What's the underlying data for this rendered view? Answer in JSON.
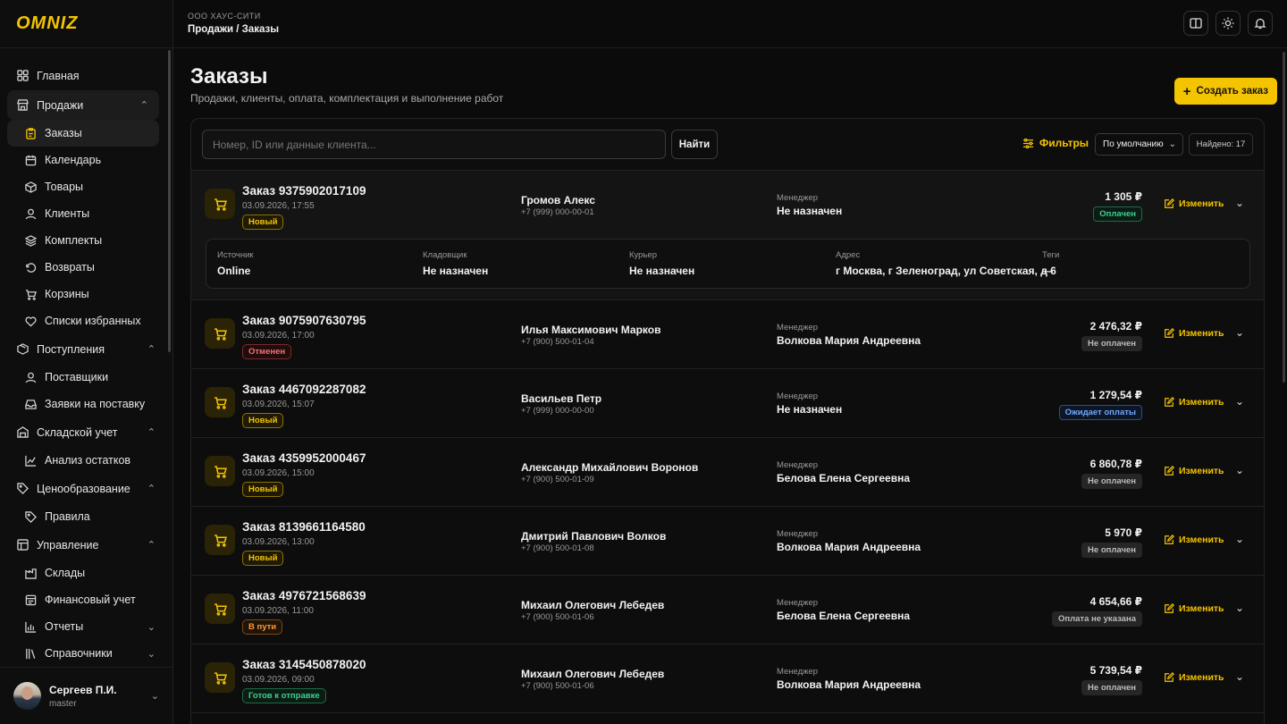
{
  "app": {
    "logo": "OMNIZ"
  },
  "header": {
    "company": "ООО ХАУС-СИТИ",
    "breadcrumb": "Продажи / Заказы"
  },
  "sidebar": {
    "items": [
      {
        "label": "Главная"
      },
      {
        "label": "Продажи"
      },
      {
        "label": "Заказы"
      },
      {
        "label": "Календарь"
      },
      {
        "label": "Товары"
      },
      {
        "label": "Клиенты"
      },
      {
        "label": "Комплекты"
      },
      {
        "label": "Возвраты"
      },
      {
        "label": "Корзины"
      },
      {
        "label": "Списки избранных"
      },
      {
        "label": "Поступления"
      },
      {
        "label": "Поставщики"
      },
      {
        "label": "Заявки на поставку"
      },
      {
        "label": "Складской учет"
      },
      {
        "label": "Анализ остатков"
      },
      {
        "label": "Ценообразование"
      },
      {
        "label": "Правила"
      },
      {
        "label": "Управление"
      },
      {
        "label": "Склады"
      },
      {
        "label": "Финансовый учет"
      },
      {
        "label": "Отчеты"
      },
      {
        "label": "Справочники"
      }
    ]
  },
  "user": {
    "name": "Сергеев П.И.",
    "role": "master"
  },
  "page": {
    "title": "Заказы",
    "subtitle": "Продажи, клиенты, оплата, комплектация и выполнение работ",
    "create_label": "Создать заказ"
  },
  "toolbar": {
    "search_placeholder": "Номер, ID или данные клиента...",
    "find_label": "Найти",
    "filters_label": "Фильтры",
    "sort_value": "По умолчанию",
    "found": "Найдено: 17"
  },
  "details_labels": {
    "source": "Источник",
    "storekeeper": "Кладовщик",
    "courier": "Курьер",
    "address": "Адрес",
    "tags": "Теги"
  },
  "manager_label": "Менеджер",
  "edit_label": "Изменить",
  "orders": [
    {
      "title": "Заказ 9375902017109",
      "date": "03.09.2026, 17:55",
      "status": "Новый",
      "client": "Громов Алекс",
      "phone": "+7 (999) 000-00-01",
      "manager": "Не назначен",
      "sum": "1 305 ₽",
      "payment": "Оплачен",
      "details": {
        "source": "Online",
        "storekeeper": "Не назначен",
        "courier": "Не назначен",
        "address": "г Москва, г Зеленоград, ул Советская, д 6",
        "tags": "—"
      }
    },
    {
      "title": "Заказ 9075907630795",
      "date": "03.09.2026, 17:00",
      "status": "Отменен",
      "client": "Илья Максимович Марков",
      "phone": "+7 (900) 500-01-04",
      "manager": "Волкова Мария Андреевна",
      "sum": "2 476,32 ₽",
      "payment": "Не оплачен"
    },
    {
      "title": "Заказ 4467092287082",
      "date": "03.09.2026, 15:07",
      "status": "Новый",
      "client": "Васильев Петр",
      "phone": "+7 (999) 000-00-00",
      "manager": "Не назначен",
      "sum": "1 279,54 ₽",
      "payment": "Ожидает оплаты"
    },
    {
      "title": "Заказ 4359952000467",
      "date": "03.09.2026, 15:00",
      "status": "Новый",
      "client": "Александр Михайлович Воронов",
      "phone": "+7 (900) 500-01-09",
      "manager": "Белова Елена Сергеевна",
      "sum": "6 860,78 ₽",
      "payment": "Не оплачен"
    },
    {
      "title": "Заказ 8139661164580",
      "date": "03.09.2026, 13:00",
      "status": "Новый",
      "client": "Дмитрий Павлович Волков",
      "phone": "+7 (900) 500-01-08",
      "manager": "Волкова Мария Андреевна",
      "sum": "5 970 ₽",
      "payment": "Не оплачен"
    },
    {
      "title": "Заказ 4976721568639",
      "date": "03.09.2026, 11:00",
      "status": "В пути",
      "client": "Михаил Олегович Лебедев",
      "phone": "+7 (900) 500-01-06",
      "manager": "Белова Елена Сергеевна",
      "sum": "4 654,66 ₽",
      "payment": "Оплата не указана"
    },
    {
      "title": "Заказ 3145450878020",
      "date": "03.09.2026, 09:00",
      "status": "Готов к отправке",
      "client": "Михаил Олегович Лебедев",
      "phone": "+7 (900) 500-01-06",
      "manager": "Волкова Мария Андреевна",
      "sum": "5 739,54 ₽",
      "payment": "Не оплачен"
    }
  ],
  "colors": {
    "accent": "#f5c400",
    "background": "#0b0b0b"
  }
}
